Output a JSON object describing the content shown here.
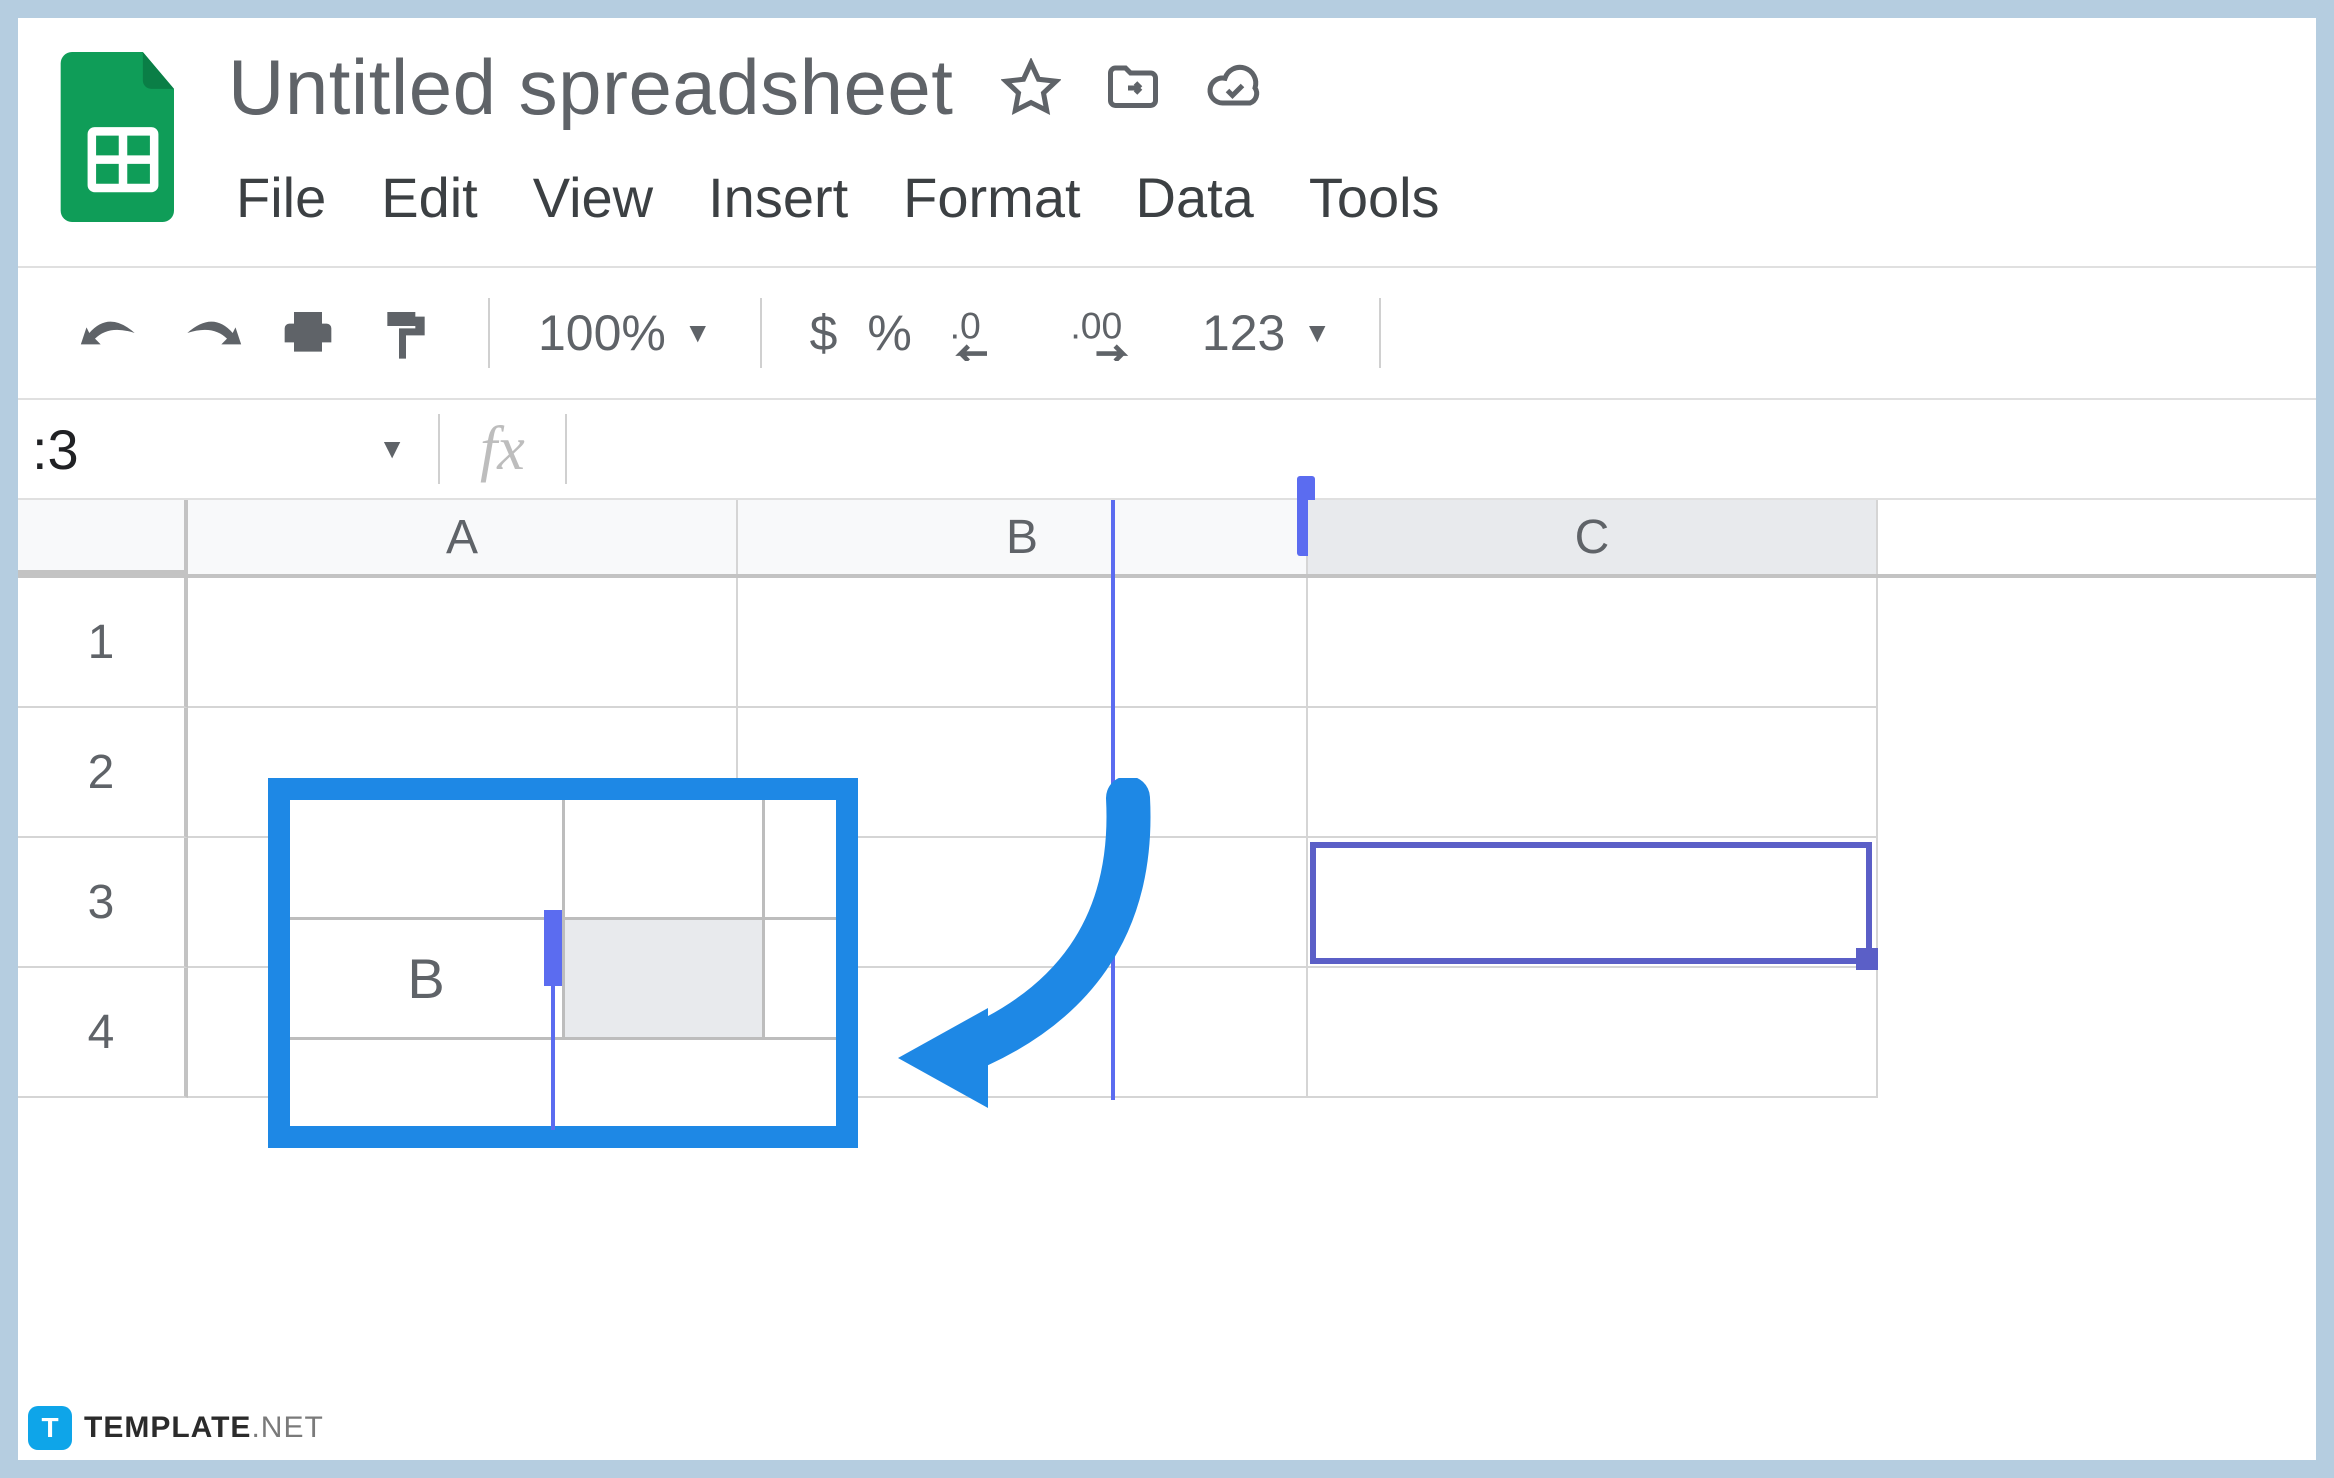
{
  "doc": {
    "title": "Untitled spreadsheet"
  },
  "menu": {
    "file": "File",
    "edit": "Edit",
    "view": "View",
    "insert": "Insert",
    "format": "Format",
    "data": "Data",
    "tools": "Tools"
  },
  "toolbar": {
    "zoom": "100%",
    "currency": "$",
    "percent": "%",
    "dec_decrease": ".0",
    "dec_increase": ".00",
    "more_formats": "123"
  },
  "formula_bar": {
    "name_box": ":3",
    "fx": "fx"
  },
  "columns": {
    "A": "A",
    "B": "B",
    "C": "C"
  },
  "rows": {
    "r1": "1",
    "r2": "2",
    "r3": "3",
    "r4": "4"
  },
  "callout": {
    "label": "B"
  },
  "watermark": {
    "badge": "T",
    "brand": "TEMPLATE",
    "suffix": ".NET"
  },
  "selection": {
    "cell": "C3"
  }
}
